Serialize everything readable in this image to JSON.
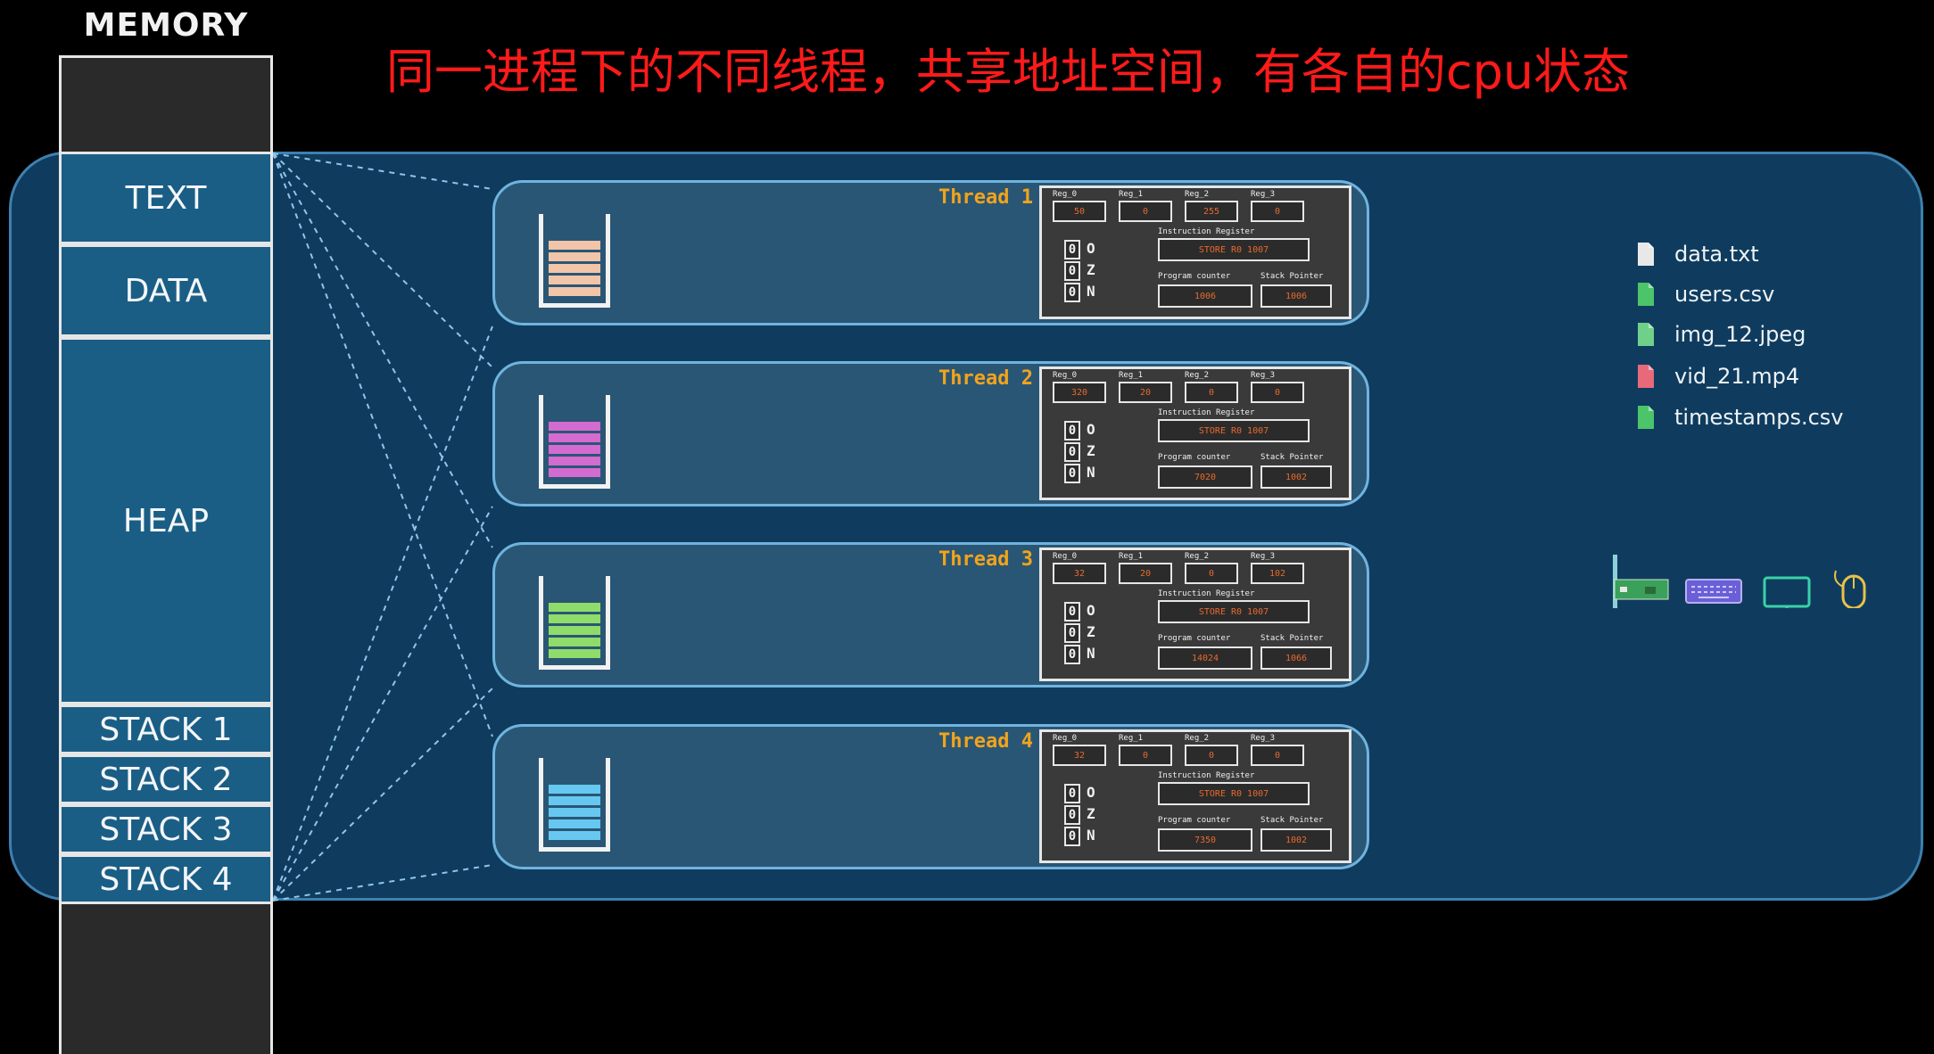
{
  "title": "MEMORY",
  "caption": "同一进程下的不同线程，共享地址空间，有各自的cpu状态",
  "memory_segments": {
    "text": "TEXT",
    "data": "DATA",
    "heap": "HEAP",
    "stack1": "STACK 1",
    "stack2": "STACK 2",
    "stack3": "STACK 3",
    "stack4": "STACK 4"
  },
  "cpu_labels": {
    "reg0": "Reg_0",
    "reg1": "Reg_1",
    "reg2": "Reg_2",
    "reg3": "Reg_3",
    "instruction_register": "Instruction Register",
    "program_counter": "Program counter",
    "stack_pointer": "Stack Pointer",
    "flag_o": "O",
    "flag_z": "Z",
    "flag_n": "N"
  },
  "threads": [
    {
      "name": "Thread 1",
      "stack_color": "#f2c4a8",
      "regs": [
        "50",
        "0",
        "255",
        "0"
      ],
      "flags": [
        "0",
        "0",
        "0"
      ],
      "instruction": "STORE R0 1007",
      "program_counter": "1006",
      "stack_pointer": "1006"
    },
    {
      "name": "Thread 2",
      "stack_color": "#d46bd0",
      "regs": [
        "320",
        "20",
        "0",
        "0"
      ],
      "flags": [
        "0",
        "0",
        "0"
      ],
      "instruction": "STORE R0 1007",
      "program_counter": "7020",
      "stack_pointer": "1002"
    },
    {
      "name": "Thread 3",
      "stack_color": "#8fdc6a",
      "regs": [
        "32",
        "20",
        "0",
        "102"
      ],
      "flags": [
        "0",
        "0",
        "0"
      ],
      "instruction": "STORE R0 1007",
      "program_counter": "14024",
      "stack_pointer": "1066"
    },
    {
      "name": "Thread 4",
      "stack_color": "#66c8f0",
      "regs": [
        "32",
        "0",
        "0",
        "0"
      ],
      "flags": [
        "0",
        "0",
        "0"
      ],
      "instruction": "STORE R0 1007",
      "program_counter": "7350",
      "stack_pointer": "1002"
    }
  ],
  "files": [
    {
      "name": "data.txt",
      "icon": "document-icon",
      "color": "#e8e8e8"
    },
    {
      "name": "users.csv",
      "icon": "spreadsheet-icon",
      "color": "#4cc46a"
    },
    {
      "name": "img_12.jpeg",
      "icon": "image-icon",
      "color": "#6fd08a"
    },
    {
      "name": "vid_21.mp4",
      "icon": "video-icon",
      "color": "#e86a7a"
    },
    {
      "name": "timestamps.csv",
      "icon": "spreadsheet-icon",
      "color": "#4cc46a"
    }
  ],
  "devices": [
    "network-card-icon",
    "keyboard-icon",
    "monitor-icon",
    "mouse-icon"
  ],
  "colors": {
    "caption": "#ff1a1a",
    "thread_title": "#f2a41c",
    "process_bg": "#0f3c5e",
    "segment_bg": "#1a5e86"
  }
}
